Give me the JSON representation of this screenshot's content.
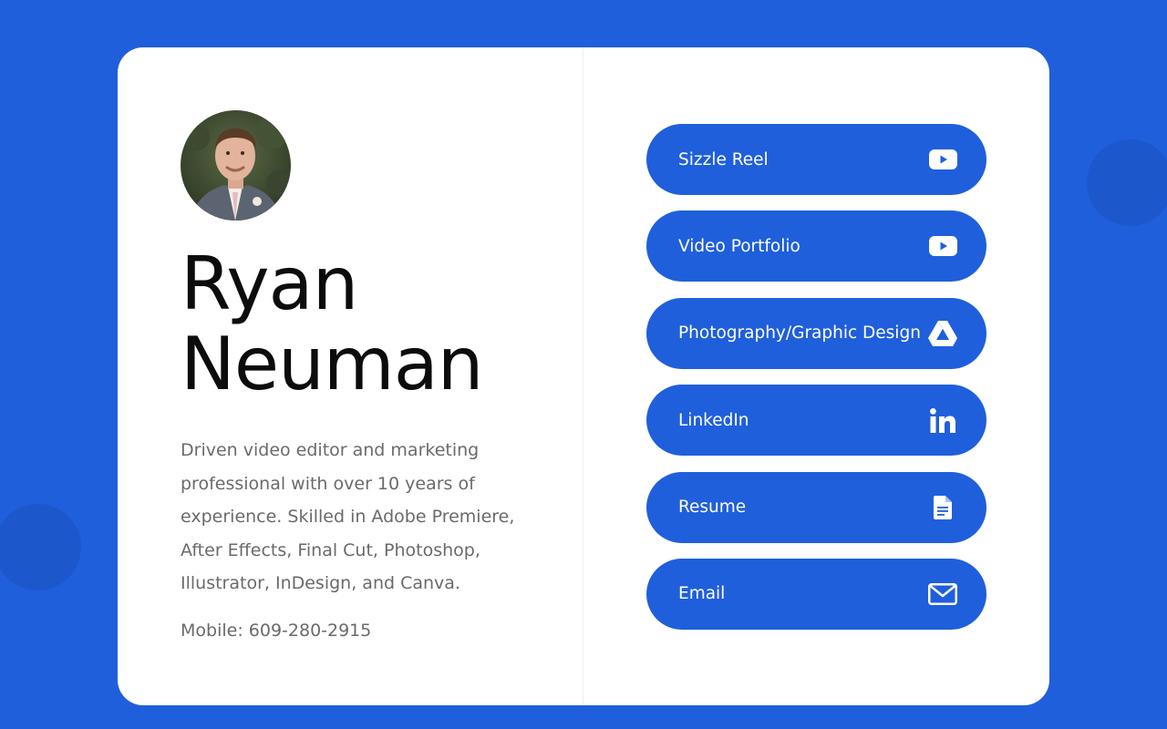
{
  "profile": {
    "first_name": "Ryan",
    "last_name": "Neuman",
    "bio": "Driven video editor and marketing professional with over 10 years of experience. Skilled in Adobe Premiere, After Effects, Final Cut, Photoshop, Illustrator, InDesign, and Canva.",
    "mobile": "Mobile: 609-280-2915"
  },
  "links": [
    {
      "label": "Sizzle Reel",
      "icon": "youtube-icon"
    },
    {
      "label": "Video Portfolio",
      "icon": "youtube-icon"
    },
    {
      "label": "Photography/Graphic Design",
      "icon": "google-drive-icon"
    },
    {
      "label": "LinkedIn",
      "icon": "linkedin-icon"
    },
    {
      "label": "Resume",
      "icon": "document-icon"
    },
    {
      "label": "Email",
      "icon": "envelope-icon"
    }
  ],
  "colors": {
    "background": "#1f5fdc",
    "card": "#ffffff",
    "button": "#1f5fdc",
    "name_text": "#0c0c0c",
    "body_text": "#6a6a6a"
  }
}
